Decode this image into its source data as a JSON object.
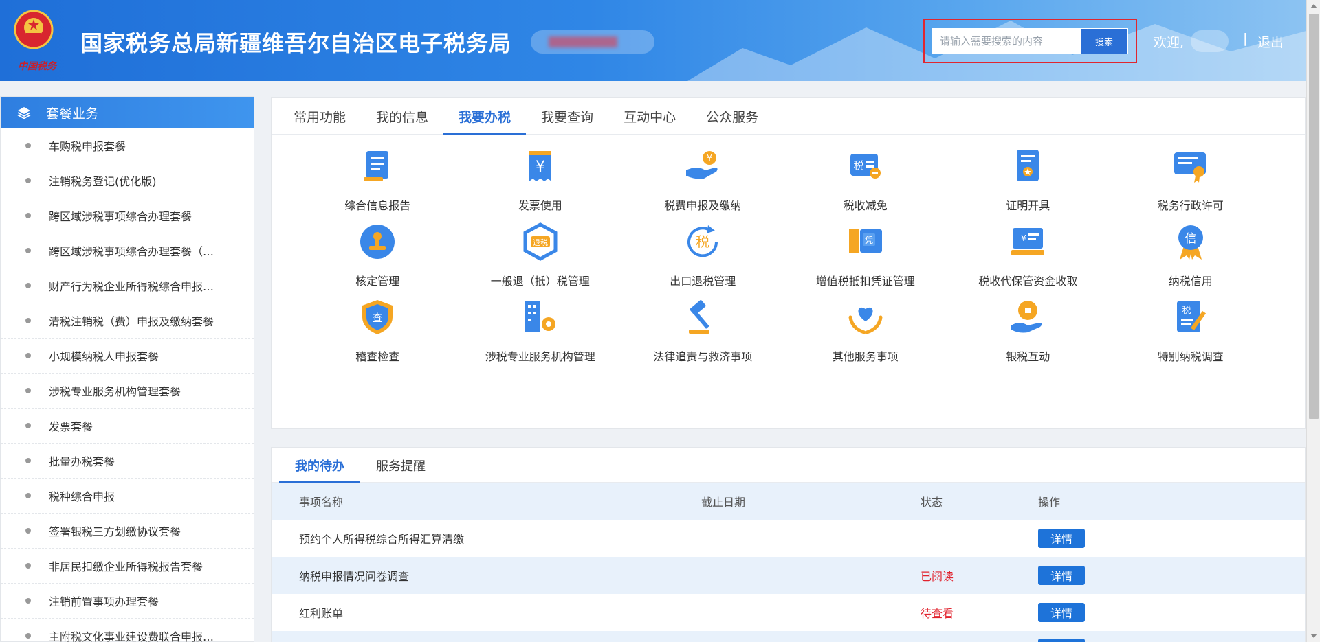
{
  "header": {
    "site_title": "国家税务总局新疆维吾尔自治区电子税务局",
    "brand_signature": "中国税务",
    "search_placeholder": "请输入需要搜索的内容",
    "search_button": "搜索",
    "welcome": "欢迎,",
    "separator": "|",
    "logout": "退出"
  },
  "sidebar": {
    "title": "套餐业务",
    "items": [
      "车购税申报套餐",
      "注销税务登记(优化版)",
      "跨区域涉税事项综合办理套餐",
      "跨区域涉税事项综合办理套餐（…",
      "财产行为税企业所得税综合申报…",
      "清税注销税（费）申报及缴纳套餐",
      "小规模纳税人申报套餐",
      "涉税专业服务机构管理套餐",
      "发票套餐",
      "批量办税套餐",
      "税种综合申报",
      "签署银税三方划缴协议套餐",
      "非居民扣缴企业所得税报告套餐",
      "注销前置事项办理套餐",
      "主附税文化事业建设费联合申报…"
    ]
  },
  "main": {
    "tabs": [
      "常用功能",
      "我的信息",
      "我要办税",
      "我要查询",
      "互动中心",
      "公众服务"
    ],
    "active_tab": 2,
    "services": [
      {
        "label": "综合信息报告",
        "icon": "report-icon"
      },
      {
        "label": "发票使用",
        "icon": "invoice-icon"
      },
      {
        "label": "税费申报及缴纳",
        "icon": "payment-icon"
      },
      {
        "label": "税收减免",
        "icon": "tax-reduction-icon"
      },
      {
        "label": "证明开具",
        "icon": "certificate-icon"
      },
      {
        "label": "税务行政许可",
        "icon": "license-icon"
      },
      {
        "label": "核定管理",
        "icon": "stamp-icon"
      },
      {
        "label": "一般退（抵）税管理",
        "icon": "refund-icon"
      },
      {
        "label": "出口退税管理",
        "icon": "export-refund-icon"
      },
      {
        "label": "增值税抵扣凭证管理",
        "icon": "voucher-icon"
      },
      {
        "label": "税收代保管资金收取",
        "icon": "custody-icon"
      },
      {
        "label": "纳税信用",
        "icon": "credit-medal-icon"
      },
      {
        "label": "稽查检查",
        "icon": "inspection-shield-icon"
      },
      {
        "label": "涉税专业服务机构管理",
        "icon": "agency-building-icon"
      },
      {
        "label": "法律追责与救济事项",
        "icon": "gavel-icon"
      },
      {
        "label": "其他服务事项",
        "icon": "heart-hands-icon"
      },
      {
        "label": "银税互动",
        "icon": "coin-hand-icon"
      },
      {
        "label": "特别纳税调查",
        "icon": "survey-icon"
      }
    ]
  },
  "todo": {
    "tabs": [
      "我的待办",
      "服务提醒"
    ],
    "columns": [
      "事项名称",
      "截止日期",
      "状态",
      "操作"
    ],
    "rows": [
      {
        "name": "预约个人所得税综合所得汇算清缴",
        "deadline": "",
        "status": "",
        "action": "详情"
      },
      {
        "name": "纳税申报情况问卷调查",
        "deadline": "",
        "status": "已阅读",
        "action": "详情"
      },
      {
        "name": "红利账单",
        "deadline": "",
        "status": "待查看",
        "action": "详情"
      }
    ]
  },
  "colors": {
    "accent": "#2a6fd6",
    "header_start": "#1f6fd8",
    "status_red": "#e1232e",
    "icon_blue": "#3a87e8",
    "icon_orange": "#f5a623"
  }
}
